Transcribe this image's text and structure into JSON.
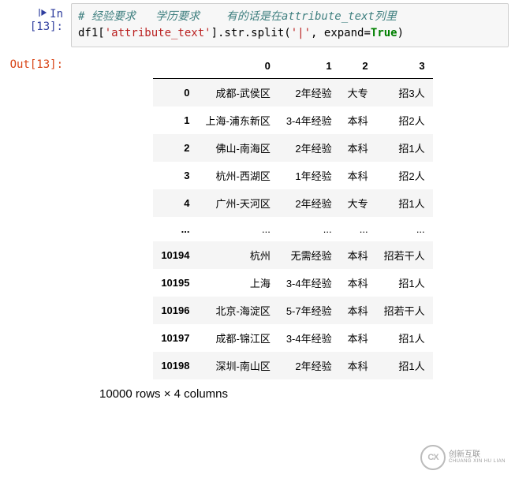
{
  "input": {
    "prompt": "In  [13]:",
    "comment": "# 经验要求   学历要求    有的话是在attribute_text列里",
    "code_pre": "df1[",
    "code_str1": "'attribute_text'",
    "code_mid1": "].str.split(",
    "code_str2": "'|'",
    "code_mid2": ", expand=",
    "code_kw": "True",
    "code_end": ")"
  },
  "output": {
    "prompt": "Out[13]:",
    "columns": [
      "0",
      "1",
      "2",
      "3"
    ],
    "rows": [
      {
        "idx": "0",
        "c0": "成都-武侯区",
        "c1": "2年经验",
        "c2": "大专",
        "c3": "招3人"
      },
      {
        "idx": "1",
        "c0": "上海-浦东新区",
        "c1": "3-4年经验",
        "c2": "本科",
        "c3": "招2人"
      },
      {
        "idx": "2",
        "c0": "佛山-南海区",
        "c1": "2年经验",
        "c2": "本科",
        "c3": "招1人"
      },
      {
        "idx": "3",
        "c0": "杭州-西湖区",
        "c1": "1年经验",
        "c2": "本科",
        "c3": "招2人"
      },
      {
        "idx": "4",
        "c0": "广州-天河区",
        "c1": "2年经验",
        "c2": "大专",
        "c3": "招1人"
      },
      {
        "idx": "...",
        "c0": "...",
        "c1": "...",
        "c2": "...",
        "c3": "..."
      },
      {
        "idx": "10194",
        "c0": "杭州",
        "c1": "无需经验",
        "c2": "本科",
        "c3": "招若干人"
      },
      {
        "idx": "10195",
        "c0": "上海",
        "c1": "3-4年经验",
        "c2": "本科",
        "c3": "招1人"
      },
      {
        "idx": "10196",
        "c0": "北京-海淀区",
        "c1": "5-7年经验",
        "c2": "本科",
        "c3": "招若干人"
      },
      {
        "idx": "10197",
        "c0": "成都-锦江区",
        "c1": "3-4年经验",
        "c2": "本科",
        "c3": "招1人"
      },
      {
        "idx": "10198",
        "c0": "深圳-南山区",
        "c1": "2年经验",
        "c2": "本科",
        "c3": "招1人"
      }
    ],
    "summary": "10000 rows × 4 columns"
  },
  "watermark": {
    "logo": "CX",
    "line1": "创新互联",
    "line2": "CHUANG XIN HU LIAN"
  }
}
